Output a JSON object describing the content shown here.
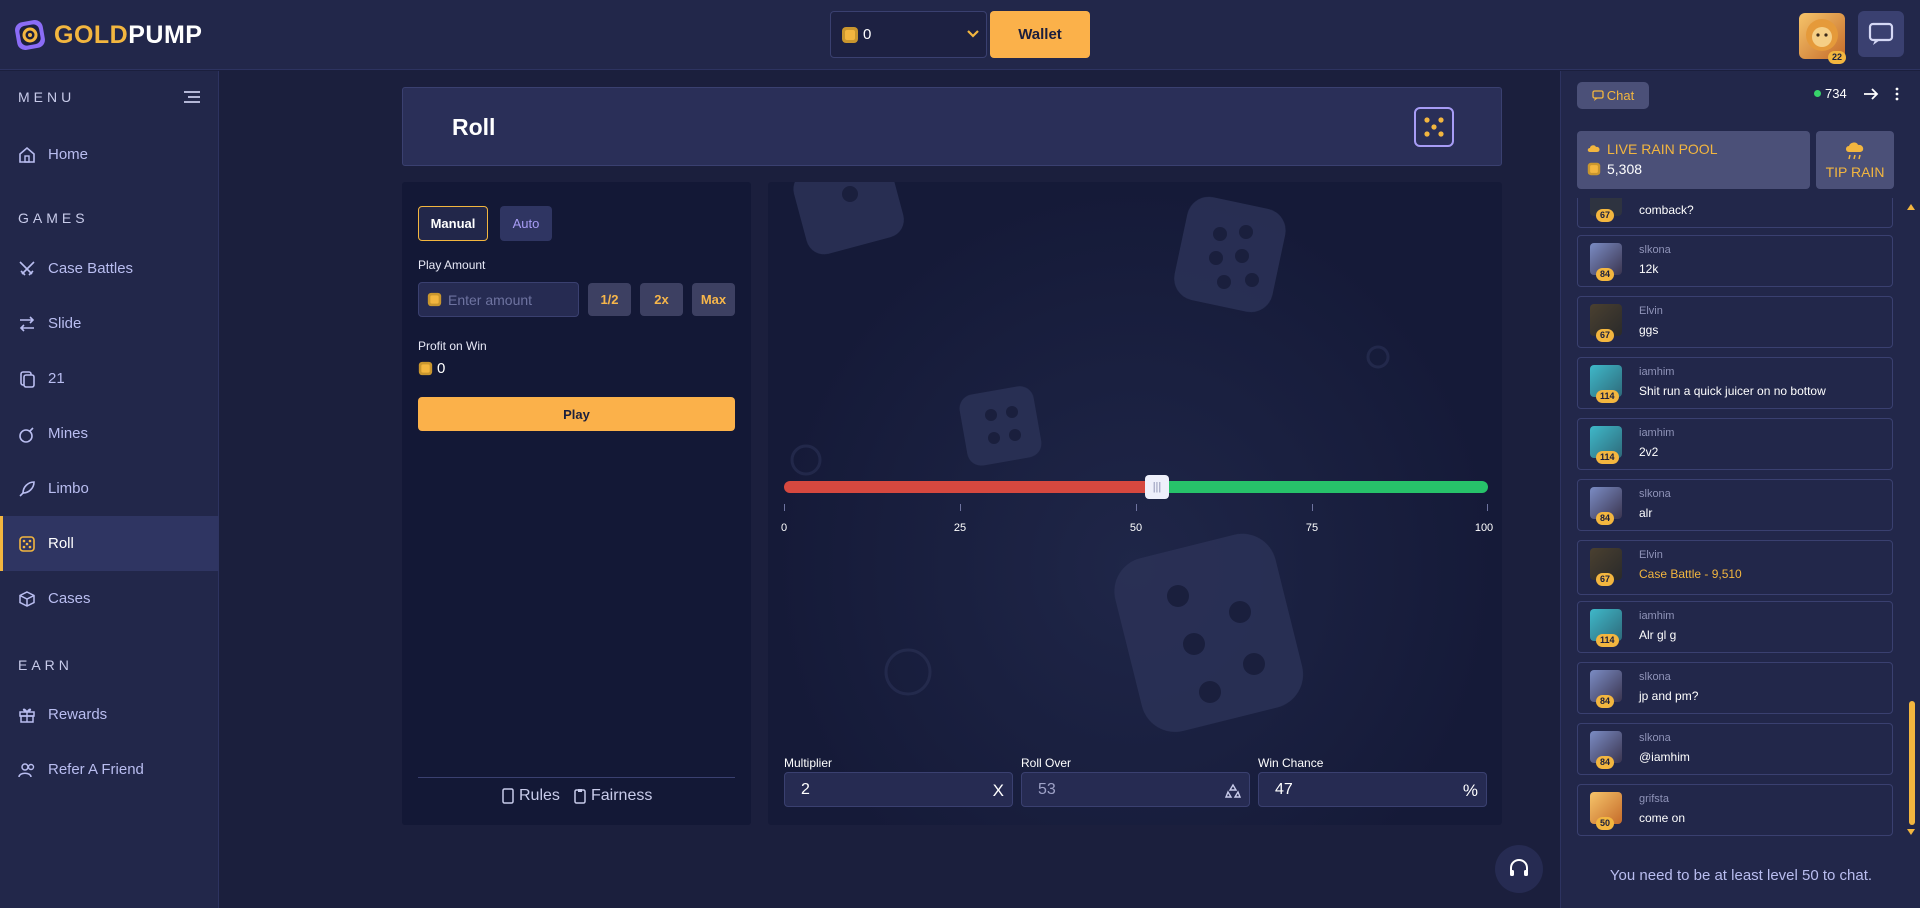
{
  "brand": {
    "name_gold": "GOLD",
    "name_white": "PUMP"
  },
  "topbar": {
    "balance": "0",
    "wallet_label": "Wallet",
    "user_level": "22"
  },
  "sidebar": {
    "menu_title": "MENU",
    "games_title": "GAMES",
    "earn_title": "EARN",
    "items": [
      {
        "label": "Home"
      },
      {
        "label": "Case Battles"
      },
      {
        "label": "Slide"
      },
      {
        "label": "21"
      },
      {
        "label": "Mines"
      },
      {
        "label": "Limbo"
      },
      {
        "label": "Roll"
      },
      {
        "label": "Cases"
      },
      {
        "label": "Rewards"
      },
      {
        "label": "Refer A Friend"
      }
    ]
  },
  "page": {
    "title": "Roll"
  },
  "bet": {
    "tabs": [
      {
        "label": "Manual"
      },
      {
        "label": "Auto"
      }
    ],
    "play_amount_label": "Play Amount",
    "amount_placeholder": "Enter amount",
    "half_label": "1/2",
    "double_label": "2x",
    "max_label": "Max",
    "profit_label": "Profit on Win",
    "profit_value": "0",
    "play_label": "Play",
    "rules_label": "Rules",
    "fairness_label": "Fairness"
  },
  "roll": {
    "slider_value": 53,
    "ticks": [
      "0",
      "25",
      "50",
      "75",
      "100"
    ],
    "multiplier_label": "Multiplier",
    "multiplier_value": "2",
    "multiplier_suffix": "X",
    "roll_over_label": "Roll Over",
    "roll_over_value": "53",
    "win_chance_label": "Win Chance",
    "win_chance_value": "47",
    "win_chance_suffix": "%"
  },
  "chat": {
    "tab_label": "Chat",
    "online_count": "734",
    "rain_title": "LIVE RAIN POOL",
    "rain_amount": "5,308",
    "tip_rain_label": "TIP RAIN",
    "messages": [
      {
        "user": "",
        "text": "comback?",
        "level": "67"
      },
      {
        "user": "slkona",
        "text": "12k",
        "level": "84"
      },
      {
        "user": "Elvin",
        "text": "ggs",
        "level": "67"
      },
      {
        "user": "iamhim",
        "text": "Shit run a quick juicer on no bottow",
        "level": "114"
      },
      {
        "user": "iamhim",
        "text": "2v2",
        "level": "114"
      },
      {
        "user": "slkona",
        "text": "alr",
        "level": "84"
      },
      {
        "user": "Elvin",
        "text": "Case Battle - 9,510",
        "level": "67"
      },
      {
        "user": "iamhim",
        "text": "Alr gl g",
        "level": "114"
      },
      {
        "user": "slkona",
        "text": "jp and pm?",
        "level": "84"
      },
      {
        "user": "slkona",
        "text": "@iamhim",
        "level": "84"
      },
      {
        "user": "grifsta",
        "text": "come on",
        "level": "50"
      }
    ],
    "level_note": "You need to be at least level 50 to chat."
  },
  "colors": {
    "accent": "#fbb14a",
    "bg": "#1b1f3d",
    "panel": "#22274a",
    "lose": "#d6483f",
    "win": "#27c26a"
  }
}
